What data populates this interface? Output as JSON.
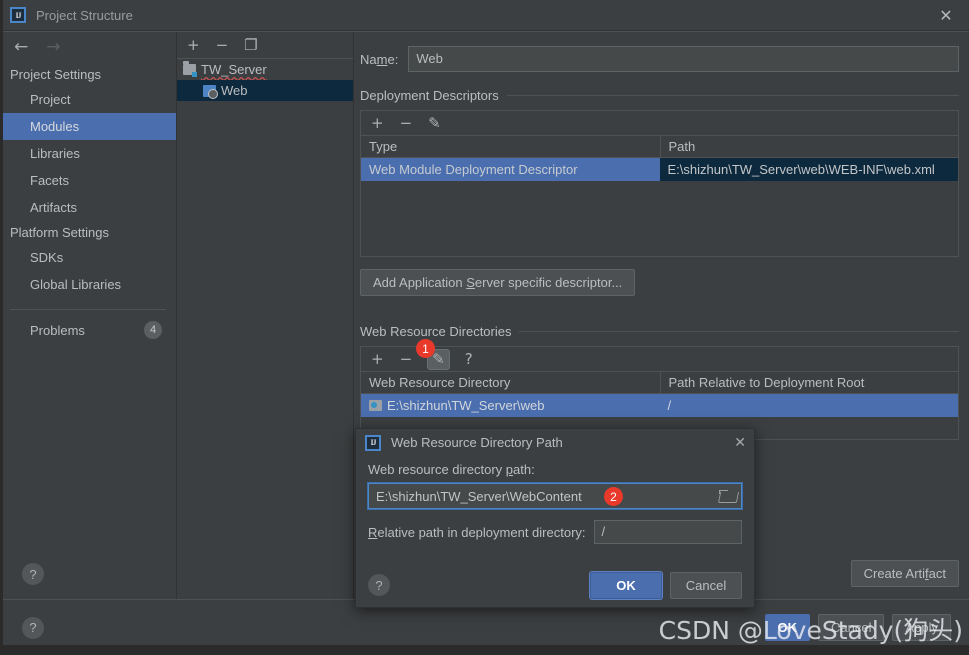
{
  "window": {
    "title": "Project Structure",
    "logo_text": "IJ",
    "close_icon": "✕"
  },
  "nav": {
    "back_icon": "←",
    "forward_icon": "→"
  },
  "sidebar": {
    "groups": [
      {
        "label": "Project Settings"
      },
      {
        "label": "Platform Settings"
      }
    ],
    "project_items": [
      {
        "label": "Project",
        "selected": false
      },
      {
        "label": "Modules",
        "selected": true
      },
      {
        "label": "Libraries",
        "selected": false
      },
      {
        "label": "Facets",
        "selected": false
      },
      {
        "label": "Artifacts",
        "selected": false
      }
    ],
    "platform_items": [
      {
        "label": "SDKs",
        "selected": false
      },
      {
        "label": "Global Libraries",
        "selected": false
      }
    ],
    "problems": {
      "label": "Problems",
      "count": "4"
    },
    "help_icon": "?"
  },
  "module_panel": {
    "toolbar": {
      "add_icon": "+",
      "remove_icon": "−",
      "copy_icon": "❐"
    },
    "tree": [
      {
        "label": "TW_Server",
        "icon": "folder-icon",
        "selected": false,
        "level": 0
      },
      {
        "label": "Web",
        "icon": "web-module-icon",
        "selected": true,
        "level": 1
      }
    ]
  },
  "content": {
    "name": {
      "label": "Name:",
      "label_pre": "Na",
      "label_accel": "m",
      "label_post": "e:",
      "value": "Web"
    },
    "deployment_descriptors": {
      "section_label": "Deployment Descriptors",
      "toolbar": {
        "add_icon": "+",
        "remove_icon": "−",
        "edit_icon": "✎"
      },
      "columns": [
        "Type",
        "Path"
      ],
      "rows": [
        {
          "type": "Web Module Deployment Descriptor",
          "path": "E:\\shizhun\\TW_Server\\web\\WEB-INF\\web.xml",
          "selected": true
        }
      ],
      "add_server_descriptor_button": {
        "pre": "Add Application ",
        "accel": "S",
        "post": "erver specific descriptor..."
      }
    },
    "web_resource_directories": {
      "section_label": "Web Resource Directories",
      "toolbar": {
        "add_icon": "+",
        "remove_icon": "−",
        "edit_icon": "✎",
        "help_icon": "?"
      },
      "columns": [
        "Web Resource Directory",
        "Path Relative to Deployment Root"
      ],
      "rows": [
        {
          "directory": "E:\\shizhun\\TW_Server\\web",
          "relative_path": "/",
          "selected": true
        }
      ]
    },
    "create_artifact_button": {
      "pre": "Create Arti",
      "accel": "f",
      "post": "act"
    }
  },
  "dialog": {
    "title": "Web Resource Directory Path",
    "logo_text": "IJ",
    "close_icon": "✕",
    "path_label": {
      "pre": "Web resource directory ",
      "accel": "p",
      "post": "ath:"
    },
    "path_value": "E:\\shizhun\\TW_Server\\WebContent",
    "browse_icon": "folder-open-icon",
    "relative_label": {
      "accel": "R",
      "post": "elative path in deployment directory:"
    },
    "relative_value": "/",
    "help_icon": "?",
    "ok_label": "OK",
    "cancel_label": "Cancel"
  },
  "footer": {
    "ok_label": "OK",
    "cancel_label": "Cancel",
    "apply_label": "Apply"
  },
  "annotations": {
    "steps": [
      {
        "id": "1",
        "target": "edit-web-resource-directory"
      },
      {
        "id": "2",
        "target": "web-resource-directory-path-input"
      }
    ]
  },
  "watermark": {
    "text": "CSDN @LoveStady(狗头)"
  },
  "colors": {
    "accent_selection": "#4b6eaf",
    "dark_selection": "#0d293e",
    "panel_bg": "#3c3f41",
    "badge_red": "#e8392b",
    "field_bg": "#45494a",
    "focus_border": "#4a88c7"
  }
}
